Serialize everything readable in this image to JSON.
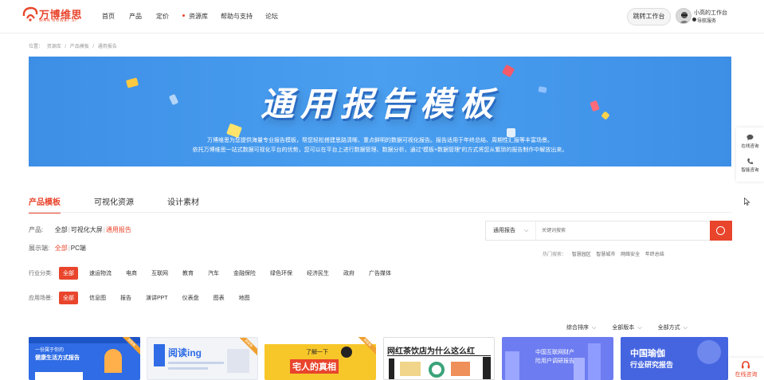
{
  "brand": {
    "name": "万博维思",
    "sub": "WAN BOWEI SI",
    "color": "#e8452c"
  },
  "nav": {
    "items": [
      "首页",
      "产品",
      "定价",
      "资源库",
      "帮助与支持",
      "论坛"
    ]
  },
  "header": {
    "workspace_button": "跳转工作台",
    "user_name": "小高的工作台",
    "user_tag": "导航服务"
  },
  "breadcrumb": [
    "位置：",
    "资源库",
    "/",
    "产品模板",
    "/",
    "通用报告"
  ],
  "banner": {
    "title": "通用报告模板",
    "desc1": "万博维思为您提供海量专业报告模板，帮您轻松搭建思路清晰、重点鲜明的数据可视化报告。报告适用于年终总结、周期性汇报等丰富场景。",
    "desc2": "依托万博维思一站式数据可视化平台的优势，您可以在平台上进行数据管理、数据分析，通过“模板+数据管理”的方式将您从繁琐的报告制作中解放出来。"
  },
  "tabs": [
    "产品模板",
    "可视化资源",
    "设计素材"
  ],
  "filters": {
    "product_label": "产品:",
    "product_options": [
      "全部",
      "可视化大屏",
      "通用报告"
    ],
    "display_label": "展示端:",
    "display_options": [
      "全部",
      "PC端"
    ]
  },
  "search": {
    "select_value": "通用报告",
    "placeholder": "关键词搜索"
  },
  "hot": {
    "label": "热门搜索：",
    "keywords": [
      "智慧园区",
      "智慧城市",
      "网络安全",
      "年终总结"
    ]
  },
  "industry": {
    "label": "行业分类:",
    "tags": [
      "全部",
      "速运物流",
      "电商",
      "互联网",
      "教育",
      "汽车",
      "金融保险",
      "绿色环保",
      "经济民生",
      "政府",
      "广告媒体"
    ]
  },
  "scene": {
    "label": "应用场景:",
    "tags": [
      "全部",
      "信息图",
      "报告",
      "演讲PPT",
      "仪表盘",
      "图表",
      "地图"
    ]
  },
  "sort": [
    "综合排序",
    "全部版本",
    "全部方式"
  ],
  "cards": [
    {
      "title": "一份属于你的",
      "title2": "健康生活方式报告",
      "bg": "#2f6ce5",
      "badge": "高级版"
    },
    {
      "title": "阅读ing",
      "title2": "",
      "bg": "#f2f4f8",
      "badge": "高级版"
    },
    {
      "title": "了解一下",
      "title2": "宅人的真相",
      "bg": "#f7c72a",
      "badge": "高级版"
    },
    {
      "title": "网红茶饮店为什么这么红",
      "title2": "",
      "bg": "#ffffff",
      "badge": ""
    },
    {
      "title": "中国互联网财产",
      "title2": "险用户调研报告",
      "bg": "#6d7cf0",
      "badge": ""
    },
    {
      "title": "中国瑜伽",
      "title2": "行业研究报告",
      "bg": "#4565e0",
      "badge": ""
    }
  ],
  "float": {
    "online": "在线咨询",
    "phone": "智能咨询",
    "bottom": "在线咨询"
  }
}
